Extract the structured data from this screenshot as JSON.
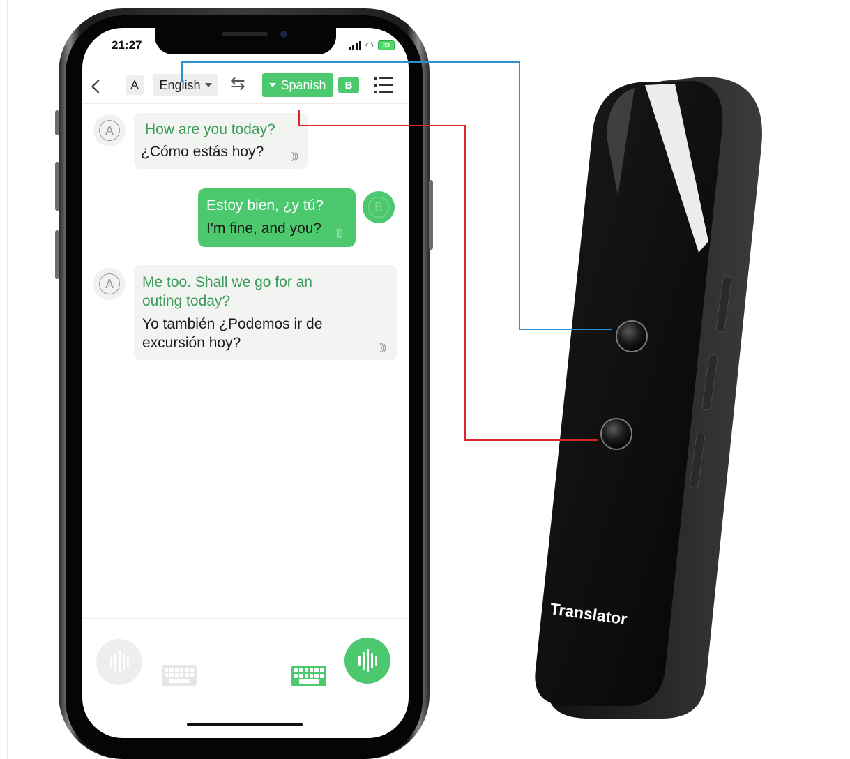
{
  "status_bar": {
    "time": "21:27",
    "battery": "33"
  },
  "nav": {
    "lang_a_badge": "A",
    "source_language": "English",
    "target_language": "Spanish",
    "lang_b_badge": "B"
  },
  "messages": [
    {
      "speaker": "A",
      "source": "How are you today?",
      "translation": "¿Cómo estás hoy?"
    },
    {
      "speaker": "B",
      "source": "Estoy bien, ¿y tú?",
      "translation": "I'm fine, and you?"
    },
    {
      "speaker": "A",
      "source_lines": [
        "Me too. Shall we go for an",
        "outing today?"
      ],
      "translation_lines": [
        "Yo también ¿Podemos ir de",
        "excursión hoy?"
      ]
    }
  ],
  "device": {
    "label": "Translator"
  },
  "colors": {
    "accent_green": "#4cc96f",
    "line_blue": "#2f8fd6",
    "line_red": "#d9262b"
  },
  "icons": [
    "back-icon",
    "swap-icon",
    "menu-icon",
    "speaker-icon",
    "microphone-icon",
    "keyboard-icon"
  ]
}
